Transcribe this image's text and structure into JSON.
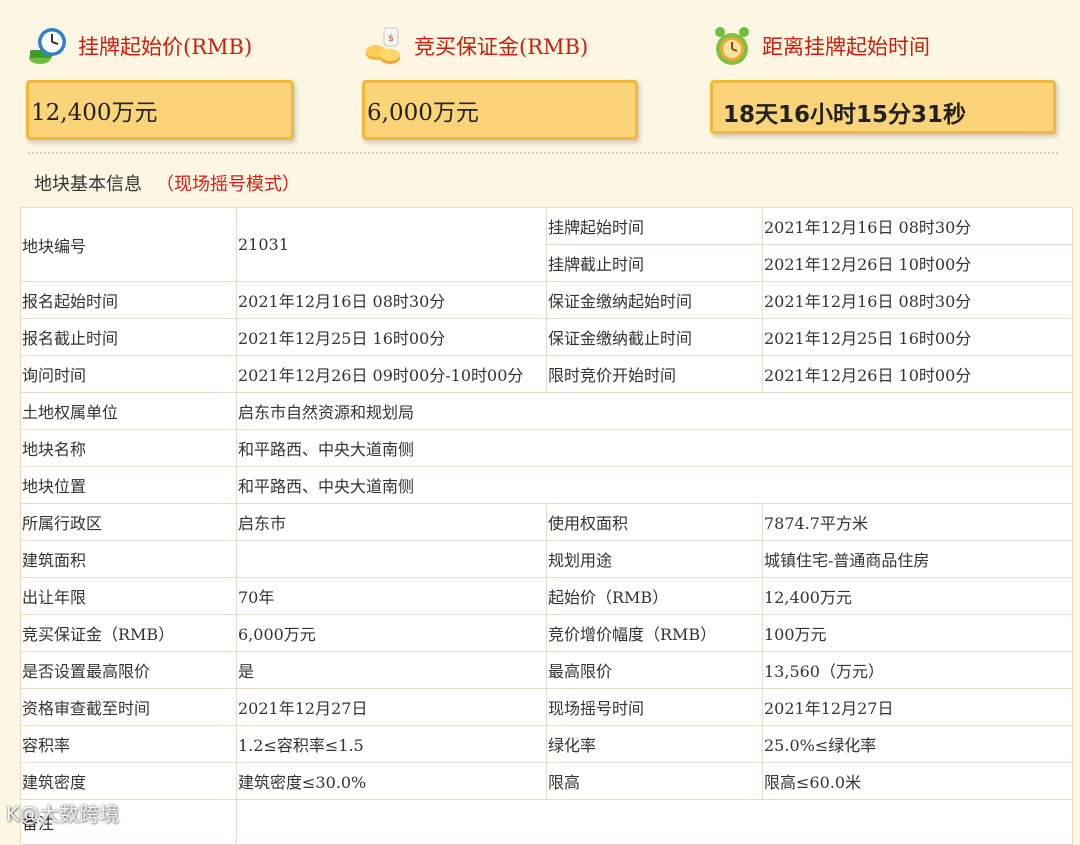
{
  "cards": [
    {
      "title": "挂牌起始价(RMB)",
      "value": "12,400万元"
    },
    {
      "title": "竞买保证金(RMB)",
      "value": "6,000万元"
    },
    {
      "title": "距离挂牌起始时间",
      "value": "18天16小时15分31秒"
    }
  ],
  "section": {
    "title": "地块基本信息",
    "mode": "（现场摇号模式）"
  },
  "table": {
    "r0": {
      "l1": "地块编号",
      "v1": "21031",
      "l2": "挂牌起始时间",
      "v2": "2021年12月16日 08时30分",
      "l3": "挂牌截止时间",
      "v3": "2021年12月26日 10时00分"
    },
    "r1": {
      "l1": "报名起始时间",
      "v1": "2021年12月16日 08时30分",
      "l2": "保证金缴纳起始时间",
      "v2": "2021年12月16日 08时30分"
    },
    "r2": {
      "l1": "报名截止时间",
      "v1": "2021年12月25日 16时00分",
      "l2": "保证金缴纳截止时间",
      "v2": "2021年12月25日 16时00分"
    },
    "r3": {
      "l1": "询问时间",
      "v1": "2021年12月26日 09时00分-10时00分",
      "l2": "限时竞价开始时间",
      "v2": "2021年12月26日 10时00分"
    },
    "r4": {
      "l1": "土地权属单位",
      "v1": "启东市自然资源和规划局"
    },
    "r5": {
      "l1": "地块名称",
      "v1": "和平路西、中央大道南侧"
    },
    "r6": {
      "l1": "地块位置",
      "v1": "和平路西、中央大道南侧"
    },
    "r7": {
      "l1": "所属行政区",
      "v1": "启东市",
      "l2": "使用权面积",
      "v2": "7874.7平方米"
    },
    "r8": {
      "l1": "建筑面积",
      "v1": "",
      "l2": "规划用途",
      "v2": "城镇住宅-普通商品住房"
    },
    "r9": {
      "l1": "出让年限",
      "v1": "70年",
      "l2": "起始价（RMB）",
      "v2": "12,400万元"
    },
    "r10": {
      "l1": "竞买保证金（RMB）",
      "v1": "6,000万元",
      "l2": "竞价增价幅度（RMB）",
      "v2": "100万元"
    },
    "r11": {
      "l1": "是否设置最高限价",
      "v1": "是",
      "l2": "最高限价",
      "v2": "13,560（万元）"
    },
    "r12": {
      "l1": "资格审查截至时间",
      "v1": "2021年12月27日",
      "l2": "现场摇号时间",
      "v2": "2021年12月27日"
    },
    "r13": {
      "l1": "容积率",
      "v1": "1.2≤容积率≤1.5",
      "l2": "绿化率",
      "v2": "25.0%≤绿化率"
    },
    "r14": {
      "l1": "建筑密度",
      "v1": "建筑密度≤30.0%",
      "l2": "限高",
      "v2": "限高≤60.0米"
    },
    "r15": {
      "l1": "备注",
      "v1": ""
    }
  },
  "watermark": "K@大数跨境",
  "icons": [
    "money-clock-icon",
    "coins-icon",
    "alarm-clock-icon"
  ]
}
